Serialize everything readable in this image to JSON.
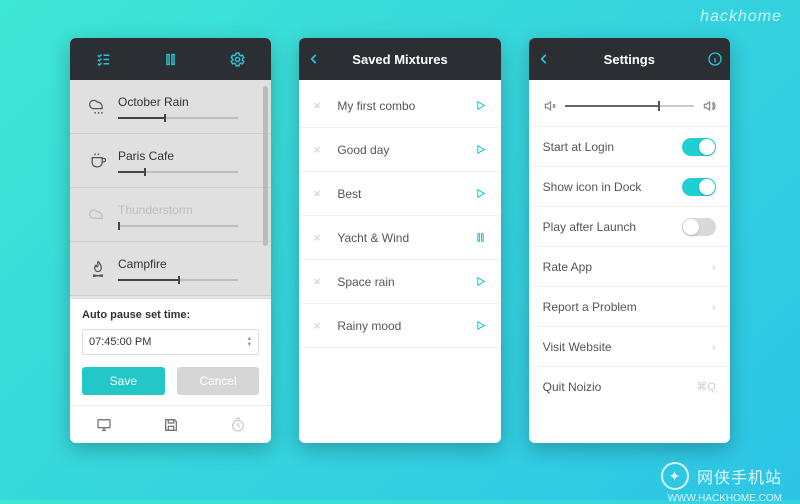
{
  "watermark": {
    "top": "hackhome",
    "site_cn": "网侠手机站",
    "site_url": "WWW.HACKHOME.COM"
  },
  "panel1": {
    "sounds": [
      {
        "name": "October Rain",
        "icon": "cloud-rain",
        "muted": false,
        "level": 0.38
      },
      {
        "name": "Paris Cafe",
        "icon": "cup",
        "muted": false,
        "level": 0.22
      },
      {
        "name": "Thunderstorm",
        "icon": "cloud",
        "muted": true,
        "level": 0.0
      },
      {
        "name": "Campfire",
        "icon": "fire",
        "muted": false,
        "level": 0.5
      }
    ],
    "autopause": {
      "title": "Auto pause set time:",
      "value": "07:45:00 PM"
    },
    "buttons": {
      "save": "Save",
      "cancel": "Cancel"
    }
  },
  "panel2": {
    "title": "Saved Mixtures",
    "items": [
      {
        "name": "My first combo",
        "state": "play"
      },
      {
        "name": "Good day",
        "state": "play"
      },
      {
        "name": "Best",
        "state": "play"
      },
      {
        "name": "Yacht & Wind",
        "state": "pause"
      },
      {
        "name": "Space rain",
        "state": "play"
      },
      {
        "name": "Rainy mood",
        "state": "play"
      }
    ]
  },
  "panel3": {
    "title": "Settings",
    "volume": 0.72,
    "rows": [
      {
        "label": "Start at Login",
        "type": "toggle",
        "on": true
      },
      {
        "label": "Show icon in Dock",
        "type": "toggle",
        "on": true
      },
      {
        "label": "Play after Launch",
        "type": "toggle",
        "on": false
      },
      {
        "label": "Rate App",
        "type": "link"
      },
      {
        "label": "Report a Problem",
        "type": "link"
      },
      {
        "label": "Visit Website",
        "type": "link"
      },
      {
        "label": "Quit Noizio",
        "type": "shortcut",
        "key": "⌘Q"
      }
    ]
  }
}
